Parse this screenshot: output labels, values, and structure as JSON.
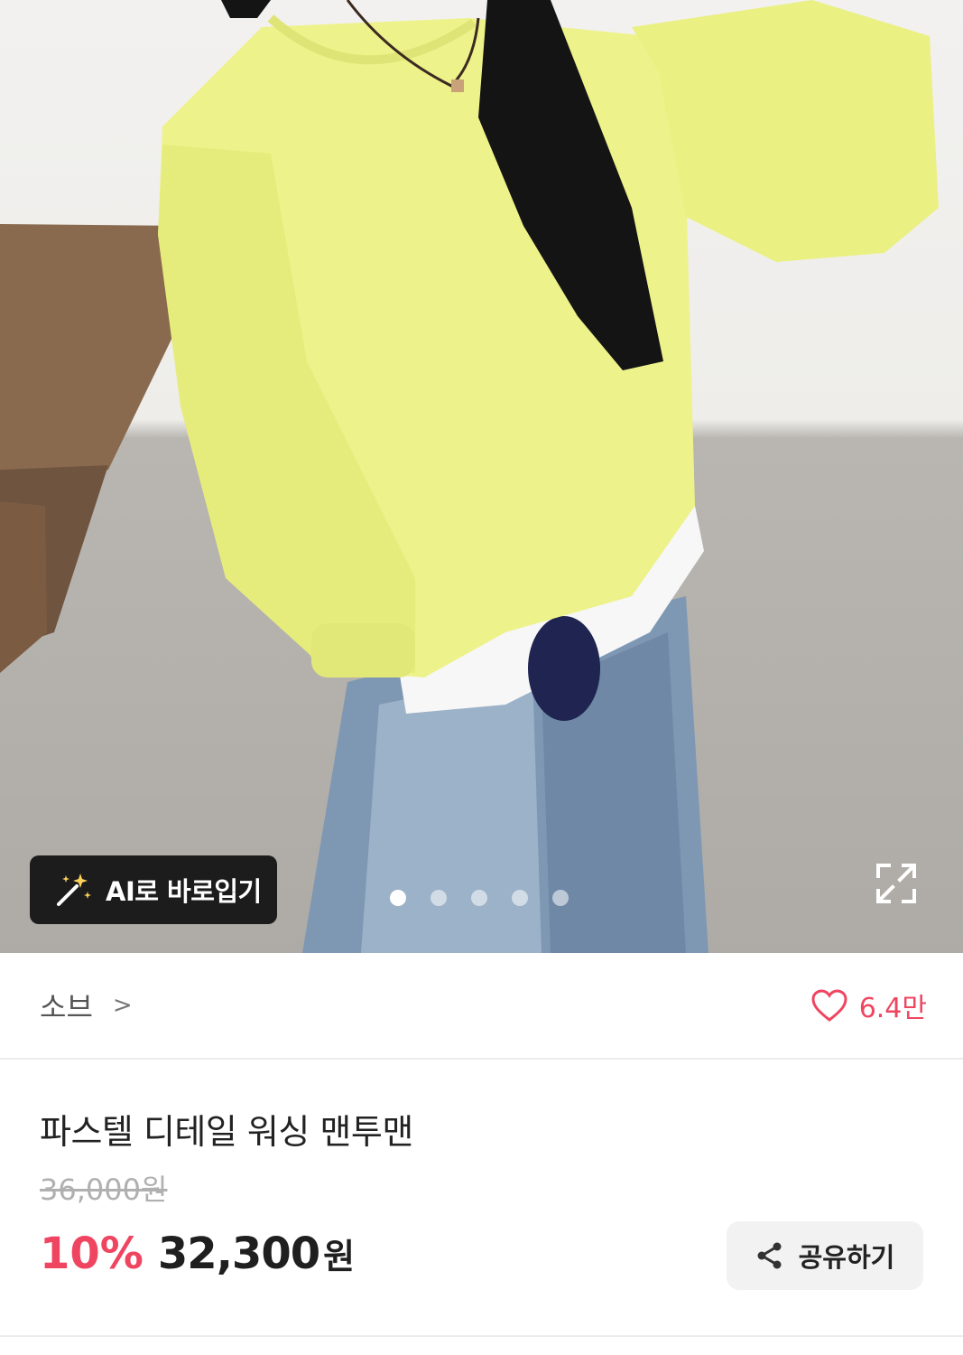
{
  "hero": {
    "ai_button_label": "AI로 바로입기",
    "carousel": {
      "total": 5,
      "active": 1
    }
  },
  "brand": {
    "name": "소브",
    "chevron": ">",
    "like_count": "6.4만"
  },
  "product": {
    "title": "파스텔 디테일 워싱 맨투맨",
    "original_price": "36,000원",
    "discount": "10%",
    "price": "32,300",
    "currency": "원"
  },
  "share": {
    "label": "공유하기"
  },
  "colors": {
    "accent": "#ef4560",
    "sweater": "#eef28a"
  },
  "icons": [
    "magic-wand-icon",
    "expand-icon",
    "heart-icon",
    "share-icon",
    "chevron-right-icon"
  ]
}
